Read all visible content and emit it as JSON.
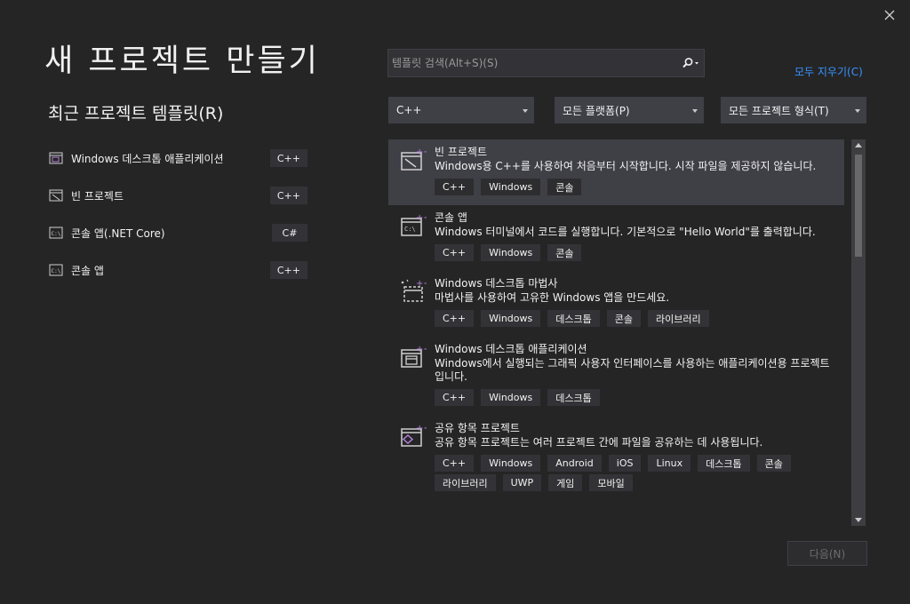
{
  "window": {
    "close_icon": "close-icon"
  },
  "title": "새 프로젝트 만들기",
  "recent": {
    "heading": "최근 프로젝트 템플릿(R)",
    "items": [
      {
        "label": "Windows 데스크톱 애플리케이션",
        "lang": "C++",
        "icon": "desktop-app-icon"
      },
      {
        "label": "빈 프로젝트",
        "lang": "C++",
        "icon": "empty-project-icon"
      },
      {
        "label": "콘솔 앱(.NET Core)",
        "lang": "C#",
        "icon": "console-app-icon"
      },
      {
        "label": "콘솔 앱",
        "lang": "C++",
        "icon": "console-app-icon"
      }
    ]
  },
  "search": {
    "placeholder": "템플릿 검색(Alt+S)(S)",
    "value": ""
  },
  "clear_all": "모두 지우기(C)",
  "filters": {
    "language": "C++",
    "platform": "모든 플랫폼(P)",
    "project_type": "모든 프로젝트 형식(T)"
  },
  "templates": [
    {
      "name": "빈 프로젝트",
      "desc": "Windows용 C++를 사용하여 처음부터 시작합니다. 시작 파일을 제공하지 않습니다.",
      "tags": [
        "C++",
        "Windows",
        "콘솔"
      ],
      "icon": "empty-project-icon",
      "selected": true
    },
    {
      "name": "콘솔 앱",
      "desc": "Windows 터미널에서 코드를 실행합니다. 기본적으로 \"Hello World\"를 출력합니다.",
      "tags": [
        "C++",
        "Windows",
        "콘솔"
      ],
      "icon": "console-app-icon",
      "selected": false
    },
    {
      "name": "Windows 데스크톱 마법사",
      "desc": "마법사를 사용하여 고유한 Windows 앱을 만드세요.",
      "tags": [
        "C++",
        "Windows",
        "데스크톱",
        "콘솔",
        "라이브러리"
      ],
      "icon": "wizard-icon",
      "selected": false
    },
    {
      "name": "Windows 데스크톱 애플리케이션",
      "desc": "Windows에서 실행되는 그래픽 사용자 인터페이스를 사용하는 애플리케이션용 프로젝트입니다.",
      "tags": [
        "C++",
        "Windows",
        "데스크톱"
      ],
      "icon": "desktop-app-icon",
      "selected": false
    },
    {
      "name": "공유 항목 프로젝트",
      "desc": "공유 항목 프로젝트는 여러 프로젝트 간에 파일을 공유하는 데 사용됩니다.",
      "tags": [
        "C++",
        "Windows",
        "Android",
        "iOS",
        "Linux",
        "데스크톱",
        "콘솔",
        "라이브러리",
        "UWP",
        "게임",
        "모바일"
      ],
      "icon": "shared-items-icon",
      "selected": false
    }
  ],
  "next_button": "다음(N)",
  "colors": {
    "background": "#252526",
    "accent_link": "#3794ff",
    "plus_accent": "#b180d7"
  }
}
